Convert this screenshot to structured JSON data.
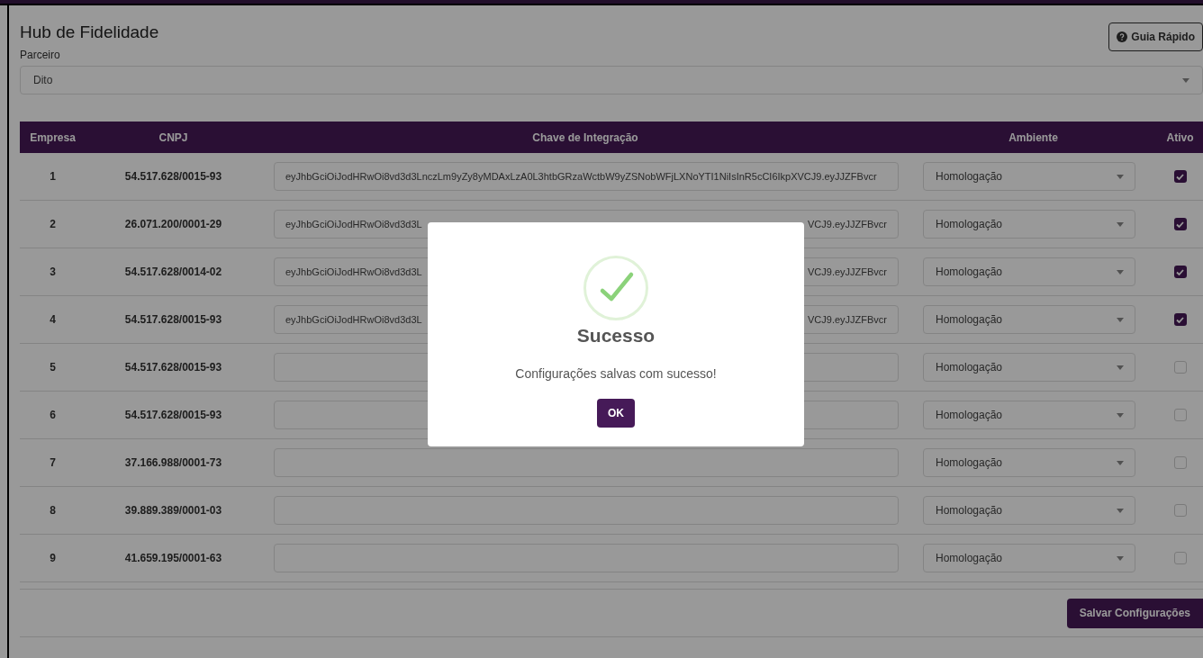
{
  "page": {
    "title": "Hub de Fidelidade",
    "help_button": "Guia Rápido",
    "partner": {
      "label": "Parceiro",
      "value": "Dito"
    }
  },
  "table": {
    "columns": [
      "Empresa",
      "CNPJ",
      "Chave de Integração",
      "Ambiente",
      "Ativo"
    ],
    "rows": [
      {
        "empresa": "1",
        "cnpj": "54.517.628/0015-93",
        "key": "eyJhbGciOiJodHRwOi8vd3d3LnczLm9yZy8yMDAxLzA0L3htbGRzaWctbW9yZSNobWFjLXNoYTI1NiIsInR5cCI6IkpXVCJ9.eyJJZFBvcr",
        "ambiente": "Homologação",
        "active": true
      },
      {
        "empresa": "2",
        "cnpj": "26.071.200/0001-29",
        "key_start": "eyJhbGciOiJodHRwOi8vd3d3L",
        "key_end": "VCJ9.eyJJZFBvcr",
        "ambiente": "Homologação",
        "active": true
      },
      {
        "empresa": "3",
        "cnpj": "54.517.628/0014-02",
        "key_start": "eyJhbGciOiJodHRwOi8vd3d3L",
        "key_end": "VCJ9.eyJJZFBvcr",
        "ambiente": "Homologação",
        "active": true
      },
      {
        "empresa": "4",
        "cnpj": "54.517.628/0015-93",
        "key_start": "eyJhbGciOiJodHRwOi8vd3d3L",
        "key_end": "VCJ9.eyJJZFBvcr",
        "ambiente": "Homologação",
        "active": true
      },
      {
        "empresa": "5",
        "cnpj": "54.517.628/0015-93",
        "ambiente": "Homologação",
        "active": false
      },
      {
        "empresa": "6",
        "cnpj": "54.517.628/0015-93",
        "ambiente": "Homologação",
        "active": false
      },
      {
        "empresa": "7",
        "cnpj": "37.166.988/0001-73",
        "ambiente": "Homologação",
        "active": false
      },
      {
        "empresa": "8",
        "cnpj": "39.889.389/0001-03",
        "ambiente": "Homologação",
        "active": false
      },
      {
        "empresa": "9",
        "cnpj": "41.659.195/0001-63",
        "ambiente": "Homologação",
        "active": false
      }
    ]
  },
  "save_button": "Salvar Configurações",
  "dialog": {
    "title": "Sucesso",
    "message": "Configurações salvas com sucesso!",
    "button": "OK"
  }
}
